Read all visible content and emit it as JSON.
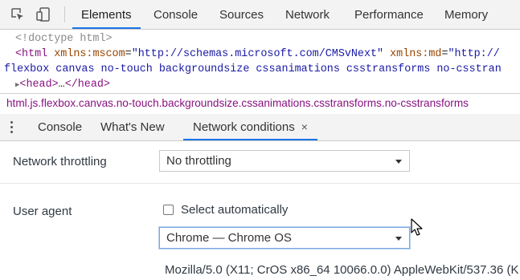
{
  "toolbar": {
    "inspect_icon": "inspect-element-icon",
    "device_icon": "device-toolbar-icon"
  },
  "main_tabs": [
    {
      "label": "Elements",
      "active": true
    },
    {
      "label": "Console"
    },
    {
      "label": "Sources"
    },
    {
      "label": "Network"
    },
    {
      "label": "Performance"
    },
    {
      "label": "Memory"
    }
  ],
  "dom_tree": {
    "doctype": "<!doctype html>",
    "html_open": "<html",
    "attr1_name": "xmlns:mscom",
    "attr1_value": "\"http://schemas.microsoft.com/CMSvNext\"",
    "attr2_name": "xmlns:md",
    "attr2_value": "\"http://",
    "class_line": "flexbox canvas no-touch backgroundsize cssanimations csstransforms no-csstran",
    "head_node": "<head>",
    "head_ellipsis": "…",
    "head_close": "</head>"
  },
  "breadcrumb": "html.js.flexbox.canvas.no-touch.backgroundsize.cssanimations.csstransforms.no-csstransforms",
  "drawer_tabs": [
    {
      "label": "Console"
    },
    {
      "label": "What's New"
    },
    {
      "label": "Network conditions",
      "active": true,
      "close": "×"
    }
  ],
  "network_conditions": {
    "throttling_label": "Network throttling",
    "throttling_value": "No throttling",
    "user_agent_label": "User agent",
    "select_auto_label": "Select automatically",
    "select_auto_checked": false,
    "user_agent_value": "Chrome — Chrome OS",
    "user_agent_string": "Mozilla/5.0 (X11; CrOS x86_64 10066.0.0) AppleWebKit/537.36 (K"
  },
  "colors": {
    "accent": "#1a73e8",
    "tag": "#881280",
    "attr_name": "#994500",
    "attr_value": "#1a1aa6"
  }
}
